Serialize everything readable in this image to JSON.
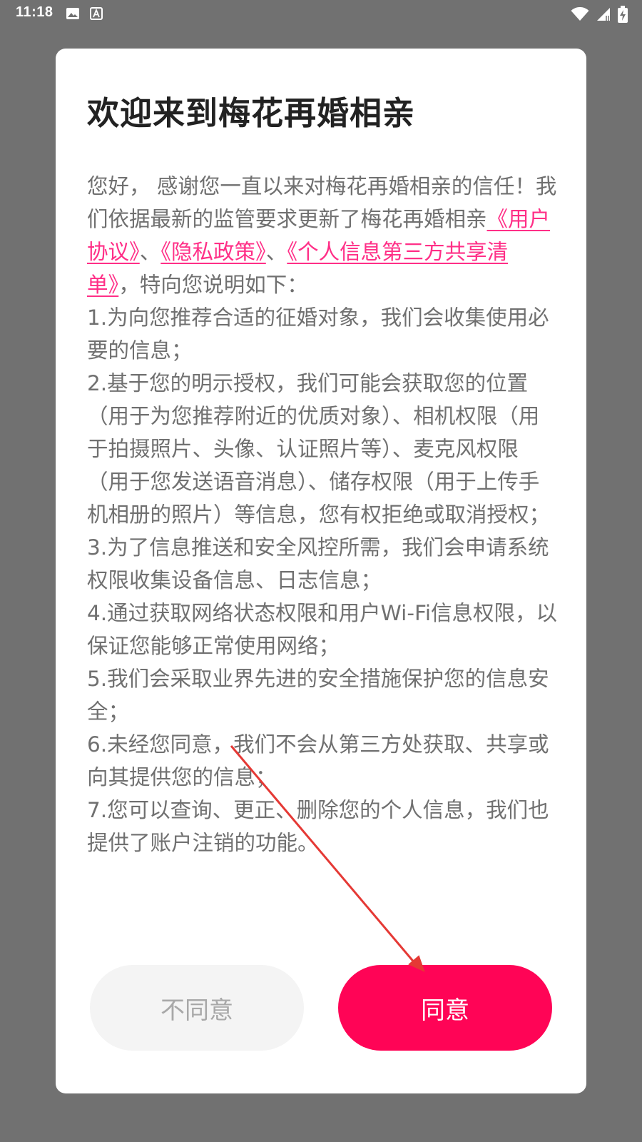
{
  "status_bar": {
    "time": "11:18",
    "left_icons": [
      "image-icon",
      "font-icon"
    ],
    "right_icons": [
      "wifi-icon",
      "cellular-signal-icon",
      "battery-charging-icon"
    ]
  },
  "dialog": {
    "title": "欢迎来到梅花再婚相亲",
    "intro": {
      "prefix": "您好， 感谢您一直以来对梅花再婚相亲的信任！我们依据最新的监管要求更新了梅花再婚相亲",
      "link_user_agreement": "《用户协议》",
      "sep1": "、",
      "link_privacy_policy": "《隐私政策》",
      "sep2": "、",
      "link_third_party_list": "《个人信息第三方共享清单》",
      "suffix": "，特向您说明如下："
    },
    "items": [
      "1.为向您推荐合适的征婚对象，我们会收集使用必要的信息；",
      "2.基于您的明示授权，我们可能会获取您的位置（用于为您推荐附近的优质对象）、相机权限（用于拍摄照片、头像、认证照片等）、麦克风权限（用于您发送语音消息）、储存权限（用于上传手机相册的照片）等信息，您有权拒绝或取消授权；",
      "3.为了信息推送和安全风控所需，我们会申请系统权限收集设备信息、日志信息；",
      "4.通过获取网络状态权限和用户Wi-Fi信息权限，以保证您能够正常使用网络；",
      "5.我们会采取业界先进的安全措施保护您的信息安全；",
      "6.未经您同意，我们不会从第三方处获取、共享或向其提供您的信息；",
      "7.您可以查询、更正、删除您的个人信息，我们也提供了账户注销的功能。"
    ],
    "disagree_label": "不同意",
    "agree_label": "同意"
  },
  "colors": {
    "overlay": "#717171",
    "link": "#ff2f87",
    "agree_button": "#ff0456",
    "disagree_button": "#f4f4f4",
    "annotation_arrow": "#e53935"
  }
}
